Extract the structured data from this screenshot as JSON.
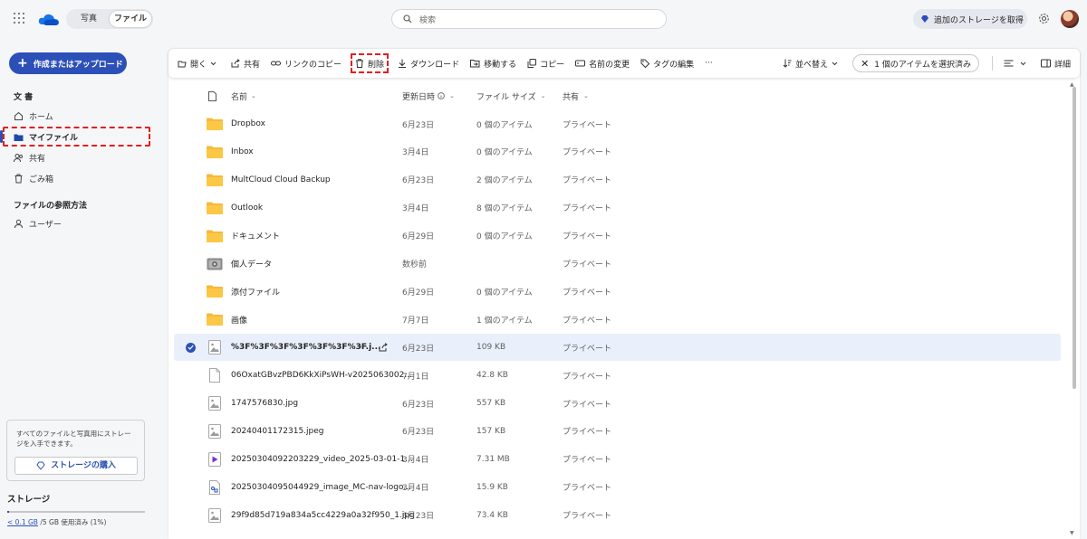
{
  "header": {
    "tabs": [
      "写真",
      "ファイル"
    ],
    "search_placeholder": "検索",
    "storage_button": "追加のストレージを取得"
  },
  "sidebar": {
    "create_button": "作成またはアップロード",
    "section1": "文 書",
    "items": [
      {
        "label": "ホーム",
        "icon": "home-icon"
      },
      {
        "label": "マイファイル",
        "icon": "folder-icon"
      },
      {
        "label": "共有",
        "icon": "people-icon"
      },
      {
        "label": "ごみ箱",
        "icon": "trash-icon"
      }
    ],
    "section2": "ファイルの参照方法",
    "items2": [
      {
        "label": "ユーザー",
        "icon": "person-icon"
      }
    ],
    "promo_text": "すべてのファイルと写真用にストレージを入手できます。",
    "buy_button": "ストレージの購入",
    "storage_title": "ストレージ",
    "storage_used": "< 0.1 GB",
    "storage_rest": " /5 GB 使用済み (1%)",
    "storage_fraction": 0.01
  },
  "toolbar": {
    "open": "開く",
    "share": "共有",
    "copy_link": "リンクのコピー",
    "delete": "削除",
    "download": "ダウンロード",
    "move": "移動する",
    "copy": "コピー",
    "rename": "名前の変更",
    "edit_tags": "タグの編集",
    "more": "···",
    "sort": "並べ替え",
    "selected": "1 個のアイテムを選択済み",
    "details": "詳細"
  },
  "columns": {
    "name": "名前",
    "modified": "更新日時",
    "size": "ファイル サイズ",
    "sharing": "共有"
  },
  "rows": [
    {
      "name": "Dropbox",
      "type": "folder",
      "modified": "6月23日",
      "size": "0 個のアイテム",
      "sharing": "プライベート"
    },
    {
      "name": "Inbox",
      "type": "folder",
      "modified": "3月4日",
      "size": "0 個のアイテム",
      "sharing": "プライベート"
    },
    {
      "name": "MultCloud Cloud Backup",
      "type": "folder",
      "modified": "6月23日",
      "size": "2 個のアイテム",
      "sharing": "プライベート"
    },
    {
      "name": "Outlook",
      "type": "folder",
      "modified": "3月4日",
      "size": "8 個のアイテム",
      "sharing": "プライベート"
    },
    {
      "name": "ドキュメント",
      "type": "folder",
      "modified": "6月29日",
      "size": "0 個のアイテム",
      "sharing": "プライベート"
    },
    {
      "name": "個人データ",
      "type": "vault",
      "modified": "数秒前",
      "size": "",
      "sharing": "プライベート"
    },
    {
      "name": "添付ファイル",
      "type": "folder",
      "modified": "6月29日",
      "size": "0 個のアイテム",
      "sharing": "プライベート"
    },
    {
      "name": "画像",
      "type": "folder",
      "modified": "7月7日",
      "size": "1 個のアイテム",
      "sharing": "プライベート"
    },
    {
      "name": "%3F%3F%3F%3F%3F%3F%3F.j...",
      "type": "image",
      "modified": "6月23日",
      "size": "109 KB",
      "sharing": "プライベート",
      "selected": true
    },
    {
      "name": "06OxatGBvzPBD6KkXiPsWH-v2025063002...",
      "type": "file",
      "modified": "7月1日",
      "size": "42.8 KB",
      "sharing": "プライベート"
    },
    {
      "name": "1747576830.jpg",
      "type": "image",
      "modified": "6月23日",
      "size": "557 KB",
      "sharing": "プライベート"
    },
    {
      "name": "20240401172315.jpeg",
      "type": "image",
      "modified": "6月23日",
      "size": "157 KB",
      "sharing": "プライベート"
    },
    {
      "name": "20250304092203229_video_2025-03-01-1...",
      "type": "video",
      "modified": "3月4日",
      "size": "7.31 MB",
      "sharing": "プライベート"
    },
    {
      "name": "20250304095044929_image_MC-nav-logo...",
      "type": "svgfile",
      "modified": "3月4日",
      "size": "15.9 KB",
      "sharing": "プライベート"
    },
    {
      "name": "29f9d85d719a834a5cc4229a0a32f950_1.jpg",
      "type": "image",
      "modified": "6月23日",
      "size": "73.4 KB",
      "sharing": "プライベート"
    }
  ]
}
